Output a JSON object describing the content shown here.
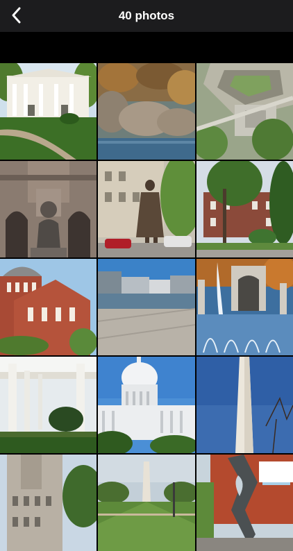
{
  "nav": {
    "title": "40 photos",
    "back_icon": "chevron-left-icon"
  },
  "photos": [
    {
      "subject": "white-house"
    },
    {
      "subject": "rocky-creek-autumn"
    },
    {
      "subject": "pentagon-aerial"
    },
    {
      "subject": "cathedral-statue"
    },
    {
      "subject": "gandhi-statue"
    },
    {
      "subject": "brick-mansion-trees"
    },
    {
      "subject": "red-brick-church"
    },
    {
      "subject": "waterfront-buildings"
    },
    {
      "subject": "wwii-memorial-fountain"
    },
    {
      "subject": "white-pergola-garden"
    },
    {
      "subject": "us-capitol"
    },
    {
      "subject": "washington-monument-closeup"
    },
    {
      "subject": "old-post-office"
    },
    {
      "subject": "national-mall-monument"
    },
    {
      "subject": "abstract-sculpture"
    }
  ]
}
